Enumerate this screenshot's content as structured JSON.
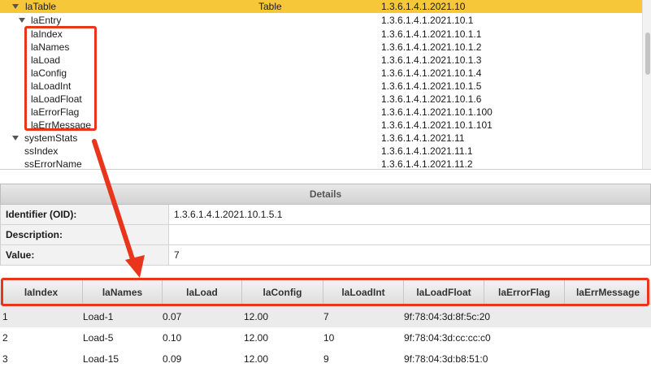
{
  "tree": {
    "rows": [
      {
        "name": "laTable",
        "type": "Table",
        "oid": "1.3.6.1.4.1.2021.10"
      },
      {
        "name": "laEntry",
        "type": "",
        "oid": "1.3.6.1.4.1.2021.10.1"
      },
      {
        "name": "laIndex",
        "type": "",
        "oid": "1.3.6.1.4.1.2021.10.1.1"
      },
      {
        "name": "laNames",
        "type": "",
        "oid": "1.3.6.1.4.1.2021.10.1.2"
      },
      {
        "name": "laLoad",
        "type": "",
        "oid": "1.3.6.1.4.1.2021.10.1.3"
      },
      {
        "name": "laConfig",
        "type": "",
        "oid": "1.3.6.1.4.1.2021.10.1.4"
      },
      {
        "name": "laLoadInt",
        "type": "",
        "oid": "1.3.6.1.4.1.2021.10.1.5"
      },
      {
        "name": "laLoadFloat",
        "type": "",
        "oid": "1.3.6.1.4.1.2021.10.1.6"
      },
      {
        "name": "laErrorFlag",
        "type": "",
        "oid": "1.3.6.1.4.1.2021.10.1.100"
      },
      {
        "name": "laErrMessage",
        "type": "",
        "oid": "1.3.6.1.4.1.2021.10.1.101"
      },
      {
        "name": "systemStats",
        "type": "",
        "oid": "1.3.6.1.4.1.2021.11"
      },
      {
        "name": "ssIndex",
        "type": "",
        "oid": "1.3.6.1.4.1.2021.11.1"
      },
      {
        "name": "ssErrorName",
        "type": "",
        "oid": "1.3.6.1.4.1.2021.11.2"
      }
    ],
    "selected_color": "#f7c73a"
  },
  "details": {
    "title": "Details",
    "rows": [
      {
        "label": "Identifier (OID):",
        "value": "1.3.6.1.4.1.2021.10.1.5.1"
      },
      {
        "label": "Description:",
        "value": ""
      },
      {
        "label": "Value:",
        "value": "7"
      }
    ]
  },
  "results": {
    "columns": [
      "laIndex",
      "laNames",
      "laLoad",
      "laConfig",
      "laLoadInt",
      "laLoadFloat",
      "laErrorFlag",
      "laErrMessage"
    ],
    "rows": [
      [
        "1",
        "Load-1",
        "0.07",
        "12.00",
        "7",
        "9f:78:04:3d:8f:5c:20",
        "",
        ""
      ],
      [
        "2",
        "Load-5",
        "0.10",
        "12.00",
        "10",
        "9f:78:04:3d:cc:cc:c0",
        "",
        ""
      ],
      [
        "3",
        "Load-15",
        "0.09",
        "12.00",
        "9",
        "9f:78:04:3d:b8:51:0",
        "",
        ""
      ]
    ]
  },
  "annotations": {
    "color": "#e8351c"
  }
}
